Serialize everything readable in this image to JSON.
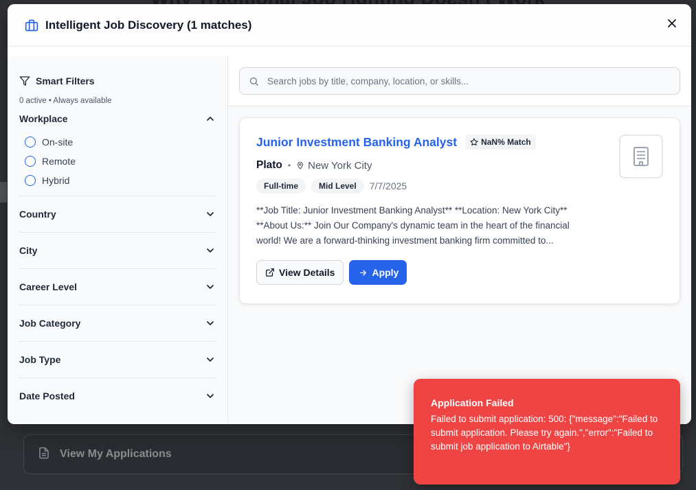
{
  "background": {
    "heading": "Why Traditional Job Hunting Doesn't Work",
    "applications_button": "View My Applications"
  },
  "modal": {
    "title": "Intelligent Job Discovery (1 matches)",
    "icon": "briefcase-icon"
  },
  "filters": {
    "title": "Smart Filters",
    "subtitle": "0 active • Always available",
    "sections": [
      {
        "title": "Workplace",
        "open": true,
        "options": [
          "On-site",
          "Remote",
          "Hybrid"
        ]
      },
      {
        "title": "Country"
      },
      {
        "title": "City"
      },
      {
        "title": "Career Level"
      },
      {
        "title": "Job Category"
      },
      {
        "title": "Job Type"
      },
      {
        "title": "Date Posted"
      }
    ]
  },
  "search": {
    "placeholder": "Search jobs by title, company, location, or skills...",
    "value": ""
  },
  "job": {
    "title": "Junior Investment Banking Analyst",
    "match": "NaN% Match",
    "company": "Plato",
    "location": "New York City",
    "tags": [
      "Full-time",
      "Mid Level"
    ],
    "date": "7/7/2025",
    "description": "**Job Title: Junior Investment Banking Analyst** **Location: New York City** **About Us:** Join Our Company's dynamic team in the heart of the financial world! We are a forward-thinking investment banking firm committed to...",
    "details_label": "View Details",
    "apply_label": "Apply"
  },
  "toast": {
    "title": "Application Failed",
    "message": "Failed to submit application: 500: {\"message\":\"Failed to submit application. Please try again.\",\"error\":\"Failed to submit job application to Airtable\"}"
  },
  "colors": {
    "accent": "#2563eb",
    "error": "#ef4444"
  }
}
